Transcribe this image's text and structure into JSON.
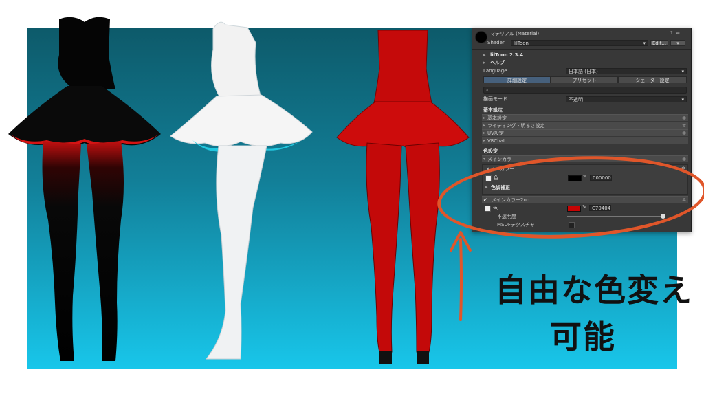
{
  "inspector": {
    "title": "マテリアル (Material)",
    "shader_label": "Shader",
    "shader_value": "lilToon",
    "edit_button": "Edit...",
    "version": "lilToon 2.3.4",
    "help": "ヘルプ",
    "language_label": "Language",
    "language_value": "日本語 (日本)",
    "tabs": [
      "詳細設定",
      "プリセット",
      "シェーダー設定"
    ],
    "search_icon": "search-icon",
    "render_mode_label": "描画モード",
    "render_mode_value": "不透明",
    "basic_header": "基本設定",
    "basic_sections": [
      "基本設定",
      "ライティング・明るさ設定",
      "UV設定",
      "VRChat"
    ],
    "color_header": "色設定",
    "main_color_section": "メインカラー",
    "main_color_sub": "メインカラー",
    "color_label": "色",
    "main_color_hex": "000000",
    "tone_correction": "色調補正",
    "main_color_2nd": "メインカラー2nd",
    "color2_hex": "C70404",
    "opacity_label": "不透明度",
    "opacity_value": "1",
    "msdf_label": "MSDFテクスチャ",
    "colors": {
      "main": "#000000",
      "second": "#c70404"
    }
  },
  "caption": {
    "line1": "自由な色変え",
    "line2": "可能"
  },
  "accent_color": "#e0562a"
}
